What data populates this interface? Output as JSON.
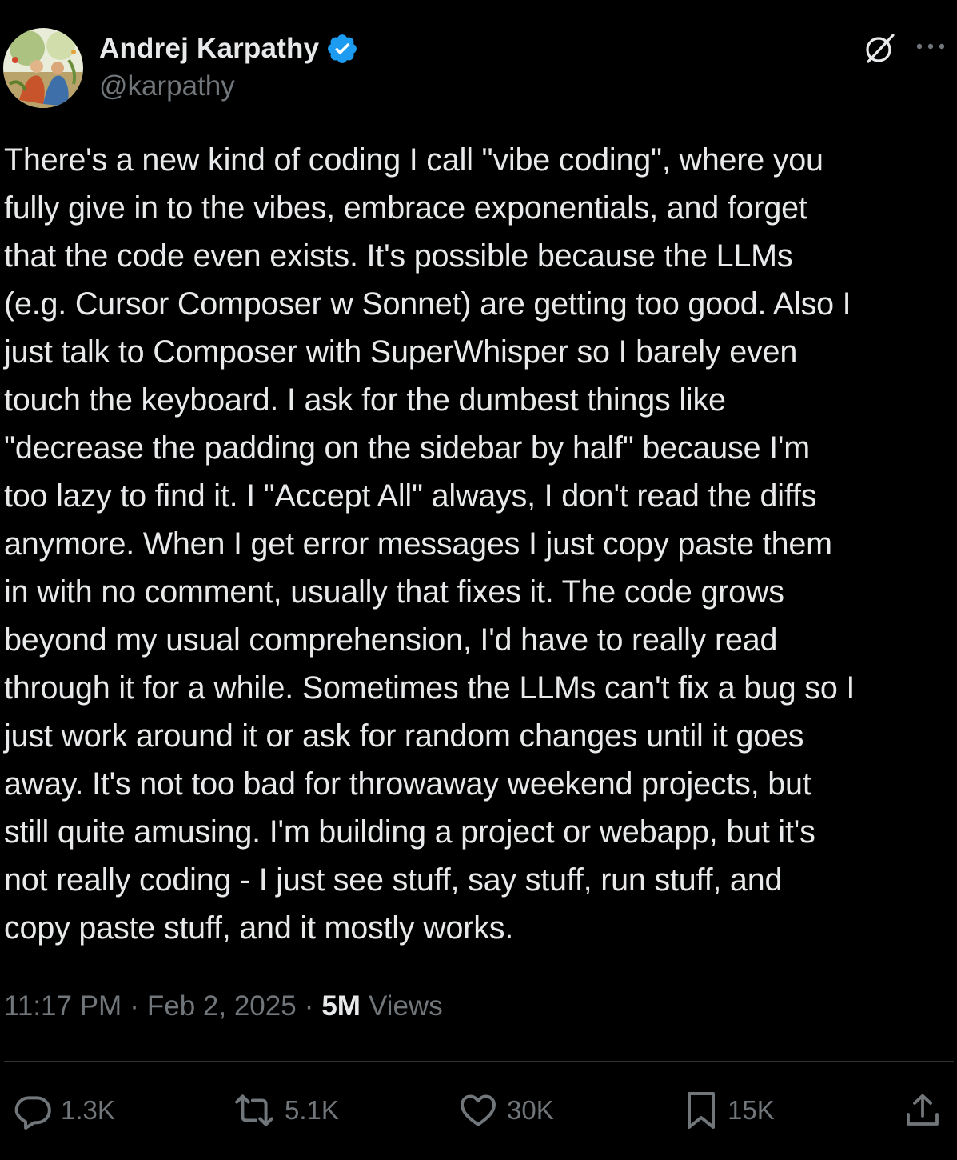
{
  "author": {
    "name": "Andrej Karpathy",
    "handle": "@karpathy",
    "verified_color": "#1d9bf0"
  },
  "tweet": {
    "text": "There's a new kind of coding I call \"vibe coding\", where you\nfully give in to the vibes, embrace exponentials, and forget\nthat the code even exists. It's possible because the LLMs\n(e.g. Cursor Composer w Sonnet) are getting too good. Also I\njust talk to Composer with SuperWhisper so I barely even\ntouch the keyboard. I ask for the dumbest things like\n\"decrease the padding on the sidebar by half\" because I'm\ntoo lazy to find it. I \"Accept All\" always, I don't read the diffs\nanymore. When I get error messages I just copy paste them\nin with no comment, usually that fixes it. The code grows\nbeyond my usual comprehension, I'd have to really read\nthrough it for a while. Sometimes the LLMs can't fix a bug so I\njust work around it or ask for random changes until it goes\naway. It's not too bad for throwaway weekend projects, but\nstill quite amusing. I'm building a project or webapp, but it's\nnot really coding - I just see stuff, say stuff, run stuff, and\ncopy paste stuff, and it mostly works."
  },
  "meta": {
    "time": "11:17 PM",
    "separator": "·",
    "date": "Feb 2, 2025",
    "views_count": "5M",
    "views_label": "Views"
  },
  "actions": {
    "replies": "1.3K",
    "reposts": "5.1K",
    "likes": "30K",
    "bookmarks": "15K"
  },
  "icons": {
    "grok": "grok-icon",
    "more": "more-icon",
    "reply": "reply-icon",
    "repost": "repost-icon",
    "like": "heart-icon",
    "bookmark": "bookmark-icon",
    "share": "share-icon"
  },
  "colors": {
    "background": "#000000",
    "text_primary": "#e7e9ea",
    "text_secondary": "#71767b",
    "divider": "#2f3336",
    "accent": "#1d9bf0"
  }
}
